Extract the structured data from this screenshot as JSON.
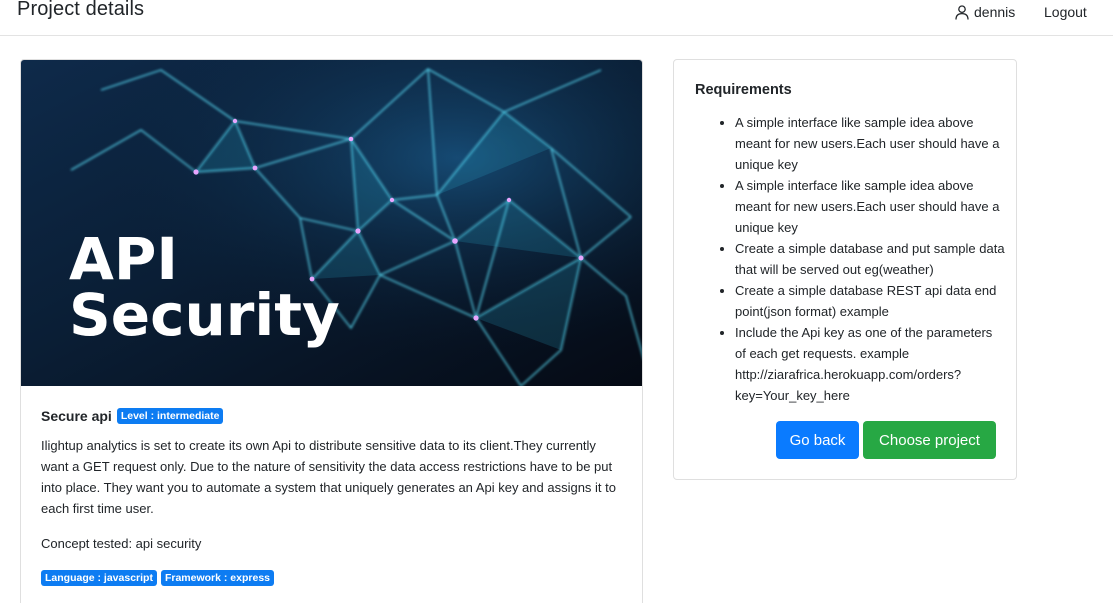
{
  "header": {
    "title": "Project details",
    "username": "dennis",
    "logout_label": "Logout"
  },
  "project": {
    "image_text_line1": "API",
    "image_text_line2": "Security",
    "name": "Secure api",
    "level_badge": "Level : intermediate",
    "description": "Ilightup analytics is set to create its own Api to distribute sensitive data to its client.They currently want a GET request only. Due to the nature of sensitivity the data access restrictions have to be put into place. They want you to automate a system that uniquely generates an Api key and assigns it to each first time user.",
    "concept": "Concept tested: api security",
    "language_badge": "Language : javascript",
    "framework_badge": "Framework : express"
  },
  "requirements": {
    "title": "Requirements",
    "items": [
      "A simple interface like sample idea above meant for new users.Each user should have a unique key",
      "A simple interface like sample idea above meant for new users.Each user should have a unique key",
      "Create a simple database and put sample data that will be served out eg(weather)",
      "Create a simple database REST api data end point(json format) example",
      "Include the Api key as one of the parameters of each get requests. example http://ziarafrica.herokuapp.com/orders?key=Your_key_here"
    ]
  },
  "actions": {
    "back_label": "Go back",
    "choose_label": "Choose project"
  },
  "colors": {
    "primary": "#0a7bff",
    "success": "#27a844",
    "badge": "#0d7cf2"
  },
  "icons": {
    "user": "user-icon"
  }
}
